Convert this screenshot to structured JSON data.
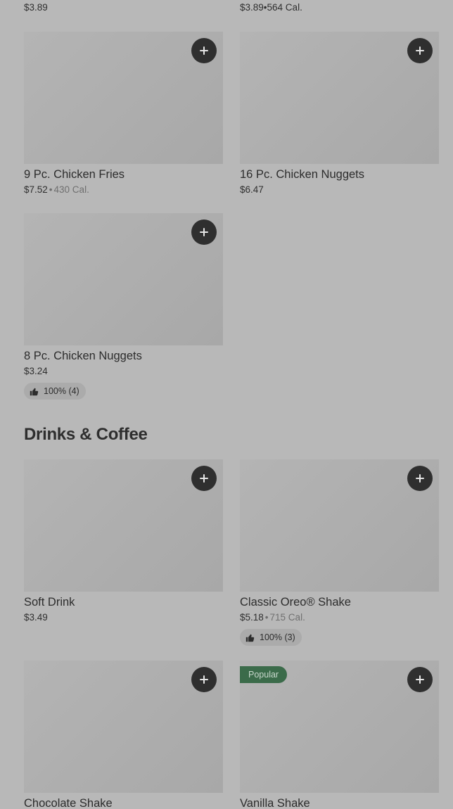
{
  "top_row": [
    {
      "price": "$3.89",
      "cal": ""
    },
    {
      "price": "$3.89",
      "cal": "564 Cal."
    }
  ],
  "items": {
    "chicken_fries_9": {
      "name": "9 Pc. Chicken Fries",
      "price": "$7.52",
      "cal": "430 Cal."
    },
    "nuggets_16": {
      "name": "16 Pc. Chicken Nuggets",
      "price": "$6.47"
    },
    "nuggets_8": {
      "name": "8 Pc. Chicken Nuggets",
      "price": "$3.24",
      "rating": "100% (4)"
    },
    "soft_drink": {
      "name": "Soft Drink",
      "price": "$3.49"
    },
    "oreo_shake": {
      "name": "Classic Oreo® Shake",
      "price": "$5.18",
      "cal": "715 Cal.",
      "rating": "100% (3)"
    },
    "chocolate_shake": {
      "name": "Chocolate Shake"
    },
    "vanilla_shake": {
      "name": "Vanilla Shake",
      "badge": "Popular"
    }
  },
  "sections": {
    "drinks_coffee": "Drinks & Coffee"
  },
  "separator": "•",
  "icons": {
    "add": "plus-icon",
    "rating": "thumbs-up-icon"
  },
  "colors": {
    "page_bg": "#b8b8b8",
    "button_bg": "#2f2f2f",
    "popular_badge": "#3b6b4a"
  }
}
